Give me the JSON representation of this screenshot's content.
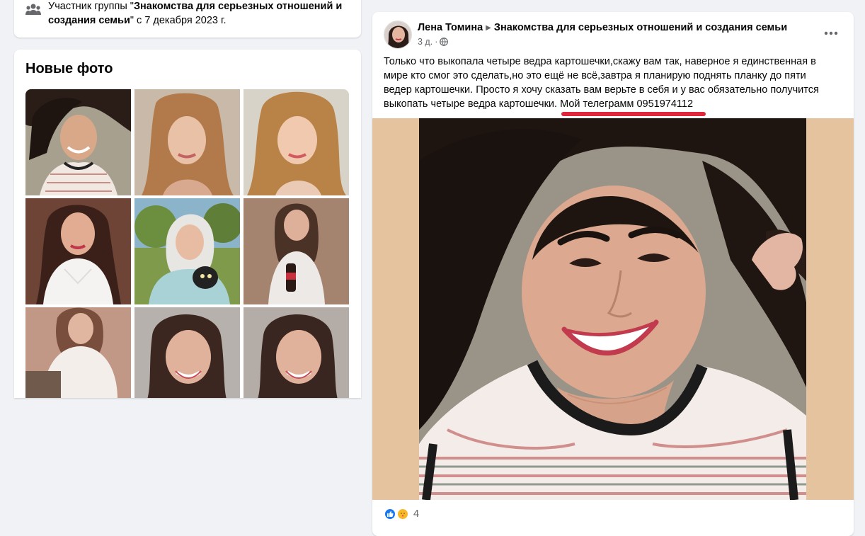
{
  "membership": {
    "prefix": "Участник группы \"",
    "group_name": "Знакомства для серьезных отношений и создания семьи",
    "suffix": "\" с 7 декабря 2023 г.",
    "icon": "group-icon"
  },
  "photos": {
    "title": "Новые фото",
    "count": 9
  },
  "post": {
    "author": "Лена Томина",
    "group": "Знакомства для серьезных отношений и создания семьи",
    "time": "3 д.",
    "privacy_icon": "globe-icon",
    "text_main": "Только что выкопала четыре ведра картошечки,скажу вам так, наверное я единственная в мире кто смог это сделать,но это ещё не всё,завтра я планирую поднять планку до пяти ведер картошечки. Просто я хочу сказать вам верьте в себя и у вас обязательно получится выкопать четыре ведра картошечки.",
    "text_highlight": "Мой телеграмм 0951974112",
    "reaction_count": "4",
    "highlight_color": "#e0263a"
  },
  "colors": {
    "page_bg": "#f0f2f5",
    "card_bg": "#ffffff",
    "image_bg": "#e5c39f",
    "secondary_text": "#65676b",
    "like_blue": "#1877f2"
  }
}
